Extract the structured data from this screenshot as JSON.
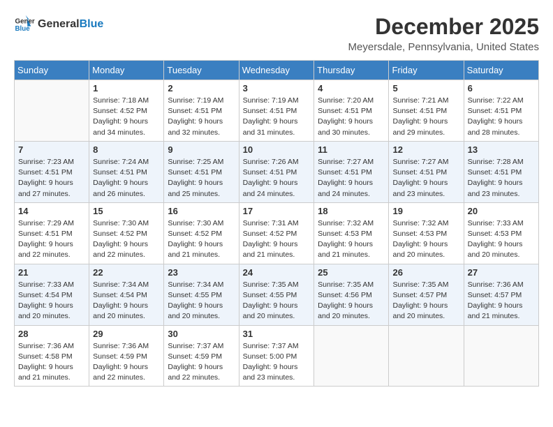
{
  "logo": {
    "general": "General",
    "blue": "Blue"
  },
  "title": "December 2025",
  "location": "Meyersdale, Pennsylvania, United States",
  "days_of_week": [
    "Sunday",
    "Monday",
    "Tuesday",
    "Wednesday",
    "Thursday",
    "Friday",
    "Saturday"
  ],
  "weeks": [
    [
      {
        "day": "",
        "sunrise": "",
        "sunset": "",
        "daylight": ""
      },
      {
        "day": "1",
        "sunrise": "Sunrise: 7:18 AM",
        "sunset": "Sunset: 4:52 PM",
        "daylight": "Daylight: 9 hours and 34 minutes."
      },
      {
        "day": "2",
        "sunrise": "Sunrise: 7:19 AM",
        "sunset": "Sunset: 4:51 PM",
        "daylight": "Daylight: 9 hours and 32 minutes."
      },
      {
        "day": "3",
        "sunrise": "Sunrise: 7:19 AM",
        "sunset": "Sunset: 4:51 PM",
        "daylight": "Daylight: 9 hours and 31 minutes."
      },
      {
        "day": "4",
        "sunrise": "Sunrise: 7:20 AM",
        "sunset": "Sunset: 4:51 PM",
        "daylight": "Daylight: 9 hours and 30 minutes."
      },
      {
        "day": "5",
        "sunrise": "Sunrise: 7:21 AM",
        "sunset": "Sunset: 4:51 PM",
        "daylight": "Daylight: 9 hours and 29 minutes."
      },
      {
        "day": "6",
        "sunrise": "Sunrise: 7:22 AM",
        "sunset": "Sunset: 4:51 PM",
        "daylight": "Daylight: 9 hours and 28 minutes."
      }
    ],
    [
      {
        "day": "7",
        "sunrise": "Sunrise: 7:23 AM",
        "sunset": "Sunset: 4:51 PM",
        "daylight": "Daylight: 9 hours and 27 minutes."
      },
      {
        "day": "8",
        "sunrise": "Sunrise: 7:24 AM",
        "sunset": "Sunset: 4:51 PM",
        "daylight": "Daylight: 9 hours and 26 minutes."
      },
      {
        "day": "9",
        "sunrise": "Sunrise: 7:25 AM",
        "sunset": "Sunset: 4:51 PM",
        "daylight": "Daylight: 9 hours and 25 minutes."
      },
      {
        "day": "10",
        "sunrise": "Sunrise: 7:26 AM",
        "sunset": "Sunset: 4:51 PM",
        "daylight": "Daylight: 9 hours and 24 minutes."
      },
      {
        "day": "11",
        "sunrise": "Sunrise: 7:27 AM",
        "sunset": "Sunset: 4:51 PM",
        "daylight": "Daylight: 9 hours and 24 minutes."
      },
      {
        "day": "12",
        "sunrise": "Sunrise: 7:27 AM",
        "sunset": "Sunset: 4:51 PM",
        "daylight": "Daylight: 9 hours and 23 minutes."
      },
      {
        "day": "13",
        "sunrise": "Sunrise: 7:28 AM",
        "sunset": "Sunset: 4:51 PM",
        "daylight": "Daylight: 9 hours and 23 minutes."
      }
    ],
    [
      {
        "day": "14",
        "sunrise": "Sunrise: 7:29 AM",
        "sunset": "Sunset: 4:51 PM",
        "daylight": "Daylight: 9 hours and 22 minutes."
      },
      {
        "day": "15",
        "sunrise": "Sunrise: 7:30 AM",
        "sunset": "Sunset: 4:52 PM",
        "daylight": "Daylight: 9 hours and 22 minutes."
      },
      {
        "day": "16",
        "sunrise": "Sunrise: 7:30 AM",
        "sunset": "Sunset: 4:52 PM",
        "daylight": "Daylight: 9 hours and 21 minutes."
      },
      {
        "day": "17",
        "sunrise": "Sunrise: 7:31 AM",
        "sunset": "Sunset: 4:52 PM",
        "daylight": "Daylight: 9 hours and 21 minutes."
      },
      {
        "day": "18",
        "sunrise": "Sunrise: 7:32 AM",
        "sunset": "Sunset: 4:53 PM",
        "daylight": "Daylight: 9 hours and 21 minutes."
      },
      {
        "day": "19",
        "sunrise": "Sunrise: 7:32 AM",
        "sunset": "Sunset: 4:53 PM",
        "daylight": "Daylight: 9 hours and 20 minutes."
      },
      {
        "day": "20",
        "sunrise": "Sunrise: 7:33 AM",
        "sunset": "Sunset: 4:53 PM",
        "daylight": "Daylight: 9 hours and 20 minutes."
      }
    ],
    [
      {
        "day": "21",
        "sunrise": "Sunrise: 7:33 AM",
        "sunset": "Sunset: 4:54 PM",
        "daylight": "Daylight: 9 hours and 20 minutes."
      },
      {
        "day": "22",
        "sunrise": "Sunrise: 7:34 AM",
        "sunset": "Sunset: 4:54 PM",
        "daylight": "Daylight: 9 hours and 20 minutes."
      },
      {
        "day": "23",
        "sunrise": "Sunrise: 7:34 AM",
        "sunset": "Sunset: 4:55 PM",
        "daylight": "Daylight: 9 hours and 20 minutes."
      },
      {
        "day": "24",
        "sunrise": "Sunrise: 7:35 AM",
        "sunset": "Sunset: 4:55 PM",
        "daylight": "Daylight: 9 hours and 20 minutes."
      },
      {
        "day": "25",
        "sunrise": "Sunrise: 7:35 AM",
        "sunset": "Sunset: 4:56 PM",
        "daylight": "Daylight: 9 hours and 20 minutes."
      },
      {
        "day": "26",
        "sunrise": "Sunrise: 7:35 AM",
        "sunset": "Sunset: 4:57 PM",
        "daylight": "Daylight: 9 hours and 20 minutes."
      },
      {
        "day": "27",
        "sunrise": "Sunrise: 7:36 AM",
        "sunset": "Sunset: 4:57 PM",
        "daylight": "Daylight: 9 hours and 21 minutes."
      }
    ],
    [
      {
        "day": "28",
        "sunrise": "Sunrise: 7:36 AM",
        "sunset": "Sunset: 4:58 PM",
        "daylight": "Daylight: 9 hours and 21 minutes."
      },
      {
        "day": "29",
        "sunrise": "Sunrise: 7:36 AM",
        "sunset": "Sunset: 4:59 PM",
        "daylight": "Daylight: 9 hours and 22 minutes."
      },
      {
        "day": "30",
        "sunrise": "Sunrise: 7:37 AM",
        "sunset": "Sunset: 4:59 PM",
        "daylight": "Daylight: 9 hours and 22 minutes."
      },
      {
        "day": "31",
        "sunrise": "Sunrise: 7:37 AM",
        "sunset": "Sunset: 5:00 PM",
        "daylight": "Daylight: 9 hours and 23 minutes."
      },
      {
        "day": "",
        "sunrise": "",
        "sunset": "",
        "daylight": ""
      },
      {
        "day": "",
        "sunrise": "",
        "sunset": "",
        "daylight": ""
      },
      {
        "day": "",
        "sunrise": "",
        "sunset": "",
        "daylight": ""
      }
    ]
  ]
}
